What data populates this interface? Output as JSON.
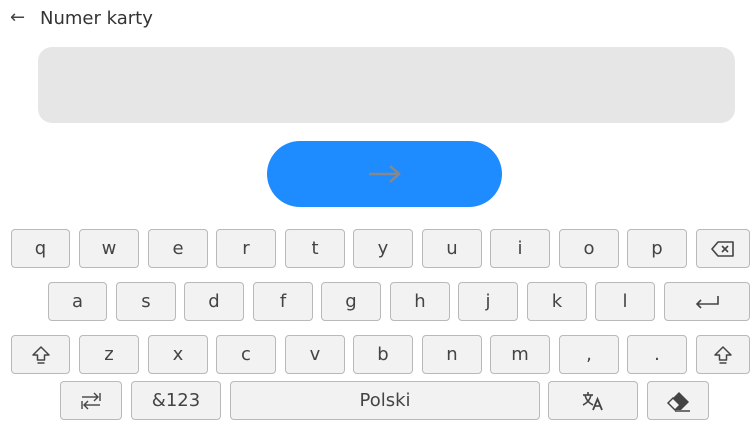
{
  "header": {
    "back_icon": "arrow-left-icon",
    "title": "Numer karty"
  },
  "input": {
    "value": "",
    "placeholder": ""
  },
  "submit": {
    "icon": "arrow-right-icon"
  },
  "keyboard": {
    "row1": [
      "q",
      "w",
      "e",
      "r",
      "t",
      "y",
      "u",
      "i",
      "o",
      "p"
    ],
    "row2": [
      "a",
      "s",
      "d",
      "f",
      "g",
      "h",
      "j",
      "k",
      "l"
    ],
    "row3": [
      "z",
      "x",
      "c",
      "v",
      "b",
      "n",
      "m",
      ",",
      "."
    ],
    "symbols_label": "&123",
    "space_label": "Polski",
    "icons": {
      "backspace": "backspace-icon",
      "enter": "enter-icon",
      "shift": "shift-icon",
      "switch": "keyboard-switch-icon",
      "translate": "translate-icon",
      "eraser": "eraser-icon"
    }
  },
  "colors": {
    "accent": "#1e8cff",
    "input_bg": "#e6e6e6",
    "key_bg": "#f2f2f2",
    "key_border": "#b9b9b9"
  }
}
